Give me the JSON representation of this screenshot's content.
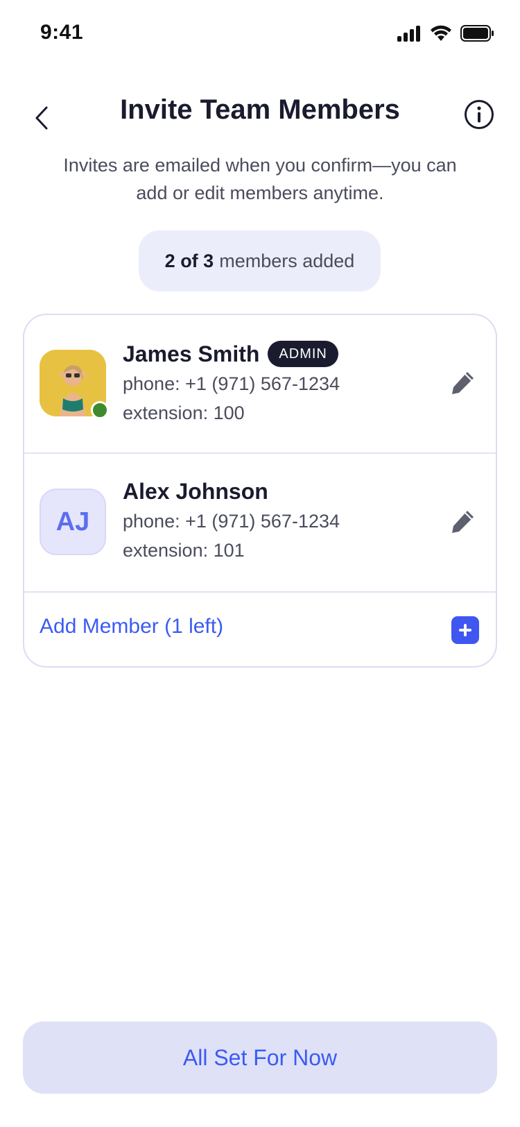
{
  "status_bar": {
    "time": "9:41",
    "icons": [
      "signal-icon",
      "wifi-icon",
      "battery-icon"
    ]
  },
  "header": {
    "title": "Invite Team Members",
    "back_icon": "chevron-left-icon",
    "info_icon": "info-icon"
  },
  "subtitle": "Invites are emailed when you confirm—you can add or edit members anytime.",
  "counter": {
    "count": "2 of 3",
    "suffix": "members added"
  },
  "members": [
    {
      "name": "James Smith",
      "badge": "ADMIN",
      "phone": "phone: +1 (971) 567-1234",
      "extension": "extension: 100",
      "avatar_type": "photo",
      "online": true
    },
    {
      "name": "Alex Johnson",
      "initials": "AJ",
      "phone": "phone: +1 (971) 567-1234",
      "extension": "extension: 101",
      "avatar_type": "initials"
    }
  ],
  "add_member": {
    "label": "Add Member (1 left)",
    "icon": "plus-icon"
  },
  "cta": {
    "label": "All Set For Now"
  },
  "colors": {
    "accent": "#3b5bf2",
    "dark": "#1a1b2e",
    "muted": "#4a4c5c",
    "chip_bg": "#ecedfb",
    "online": "#3f8a2d",
    "cta_bg": "#dfe1f7"
  }
}
